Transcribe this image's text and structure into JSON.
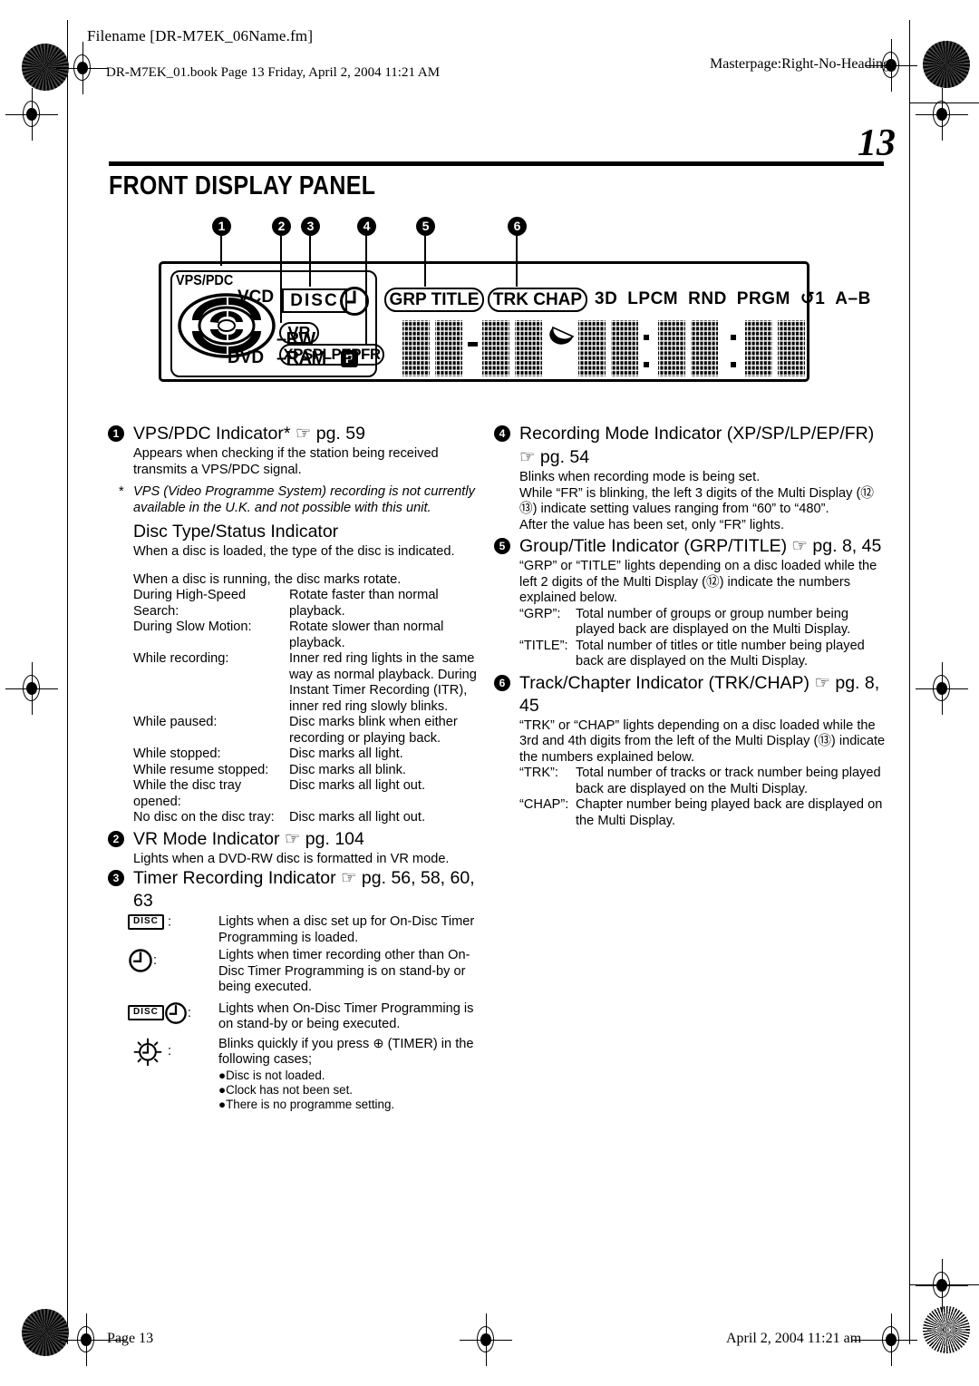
{
  "header": {
    "filename_label": "Filename [DR-M7EK_06Name.fm]",
    "book_line": "DR-M7EK_01.book  Page 13  Friday, April 2, 2004  11:21 AM",
    "masterpage": "Masterpage:Right-No-Heading"
  },
  "page": {
    "number": "13",
    "section_title": "FRONT DISPLAY PANEL"
  },
  "callouts": [
    "1",
    "2",
    "3",
    "4",
    "5",
    "6"
  ],
  "display_panel": {
    "vps_pdc": "VPS/PDC",
    "vcd": "VCD",
    "dvd": "DVD",
    "rw": "–RW",
    "ram": "–RAM",
    "p_mark": "P",
    "disc_token": "DISC",
    "vr_token": "VR",
    "mode_token": "XPSPLPEPFR",
    "grp_title_token": "GRP   TITLE",
    "trk_chap_token": "TRK CHAP",
    "flags": [
      "3D",
      "LPCM",
      "RND",
      "PRGM",
      "↺1",
      "A–B"
    ],
    "multi_display_value": "88-88 88:88:88"
  },
  "left_column": {
    "item1": {
      "num": "1",
      "title": "VPS/PDC Indicator*  ☞ pg. 59",
      "body": "Appears when checking if the station being received transmits a VPS/PDC signal.",
      "footnote_star": "*",
      "footnote": "VPS (Video Programme System) recording is not currently available in the U.K. and not possible with this unit."
    },
    "disc_status": {
      "title": "Disc Type/Status Indicator",
      "line1": "When a disc is loaded, the type of the disc is indicated.",
      "line2": "When a disc is running, the disc marks rotate.",
      "rows": [
        {
          "term": "During High-Speed Search:",
          "desc": "Rotate faster than normal playback."
        },
        {
          "term": "During Slow Motion:",
          "desc": "Rotate slower than normal playback."
        },
        {
          "term": "While recording:",
          "desc": "Inner red ring lights in the same way as normal playback. During Instant Timer Recording (ITR), inner red ring slowly blinks."
        },
        {
          "term": "While paused:",
          "desc": "Disc marks blink when either recording or playing back."
        },
        {
          "term": "While stopped:",
          "desc": "Disc marks all light."
        },
        {
          "term": "While resume stopped:",
          "desc": "Disc marks all blink."
        },
        {
          "term": "While the disc tray opened:",
          "desc": "Disc marks all light out."
        },
        {
          "term": "No disc on the disc tray:",
          "desc": "Disc marks all light out."
        }
      ]
    },
    "item2": {
      "num": "2",
      "title": "VR Mode Indicator ☞ pg. 104",
      "body": "Lights when a DVD-RW disc is formatted in VR mode."
    },
    "item3": {
      "num": "3",
      "title": "Timer Recording Indicator ☞ pg. 56, 58, 60, 63",
      "rows": [
        {
          "icon": "disc-token-icon",
          "icon_label": "DISC",
          "desc": "Lights when a disc set up for On-Disc Timer Programming is loaded."
        },
        {
          "icon": "clock-icon",
          "icon_label": "",
          "desc": "Lights when timer recording other than On-Disc Timer Programming is on stand-by or being executed."
        },
        {
          "icon": "disc-clock-icon",
          "icon_label": "DISC",
          "desc": "Lights when On-Disc Timer Programming is on stand-by or being executed."
        },
        {
          "icon": "blinking-clock-icon",
          "icon_label": "",
          "desc": "Blinks quickly if you press ⊕ (TIMER) in the following cases;"
        }
      ],
      "bullets": [
        "●Disc is not loaded.",
        "●Clock has not been set.",
        "●There is no programme setting."
      ]
    }
  },
  "right_column": {
    "item4": {
      "num": "4",
      "title": "Recording Mode Indicator (XP/SP/LP/EP/FR)",
      "title2": "☞ pg. 54",
      "lines": [
        "Blinks when recording mode is being set.",
        "While “FR” is blinking, the left 3 digits of the Multi Display (⑫ ⑬) indicate setting values ranging from “60” to “480”.",
        "After the value has been set, only “FR” lights."
      ]
    },
    "item5": {
      "num": "5",
      "title": "Group/Title Indicator (GRP/TITLE) ☞ pg. 8, 45",
      "body": "“GRP” or “TITLE” lights depending on a disc loaded while the left 2 digits of the Multi Display (⑫) indicate the numbers explained below.",
      "rows": [
        {
          "term": "“GRP”:",
          "desc": "Total number of groups or group number being played back are displayed on the Multi Display."
        },
        {
          "term": "“TITLE”:",
          "desc": "Total number of titles or title number being played back are displayed on the Multi Display."
        }
      ]
    },
    "item6": {
      "num": "6",
      "title": "Track/Chapter Indicator (TRK/CHAP) ☞ pg. 8, 45",
      "body": "“TRK” or “CHAP” lights depending on a disc loaded while the 3rd and 4th digits from the left of the Multi Display (⑬) indicate the numbers explained below.",
      "rows": [
        {
          "term": "“TRK”:",
          "desc": "Total number of tracks or track number being played back are displayed on the Multi Display."
        },
        {
          "term": "“CHAP”:",
          "desc": "Chapter number being played back are displayed on the Multi Display."
        }
      ]
    }
  },
  "footer": {
    "left": "Page 13",
    "right": "April 2, 2004 11:21 am"
  }
}
